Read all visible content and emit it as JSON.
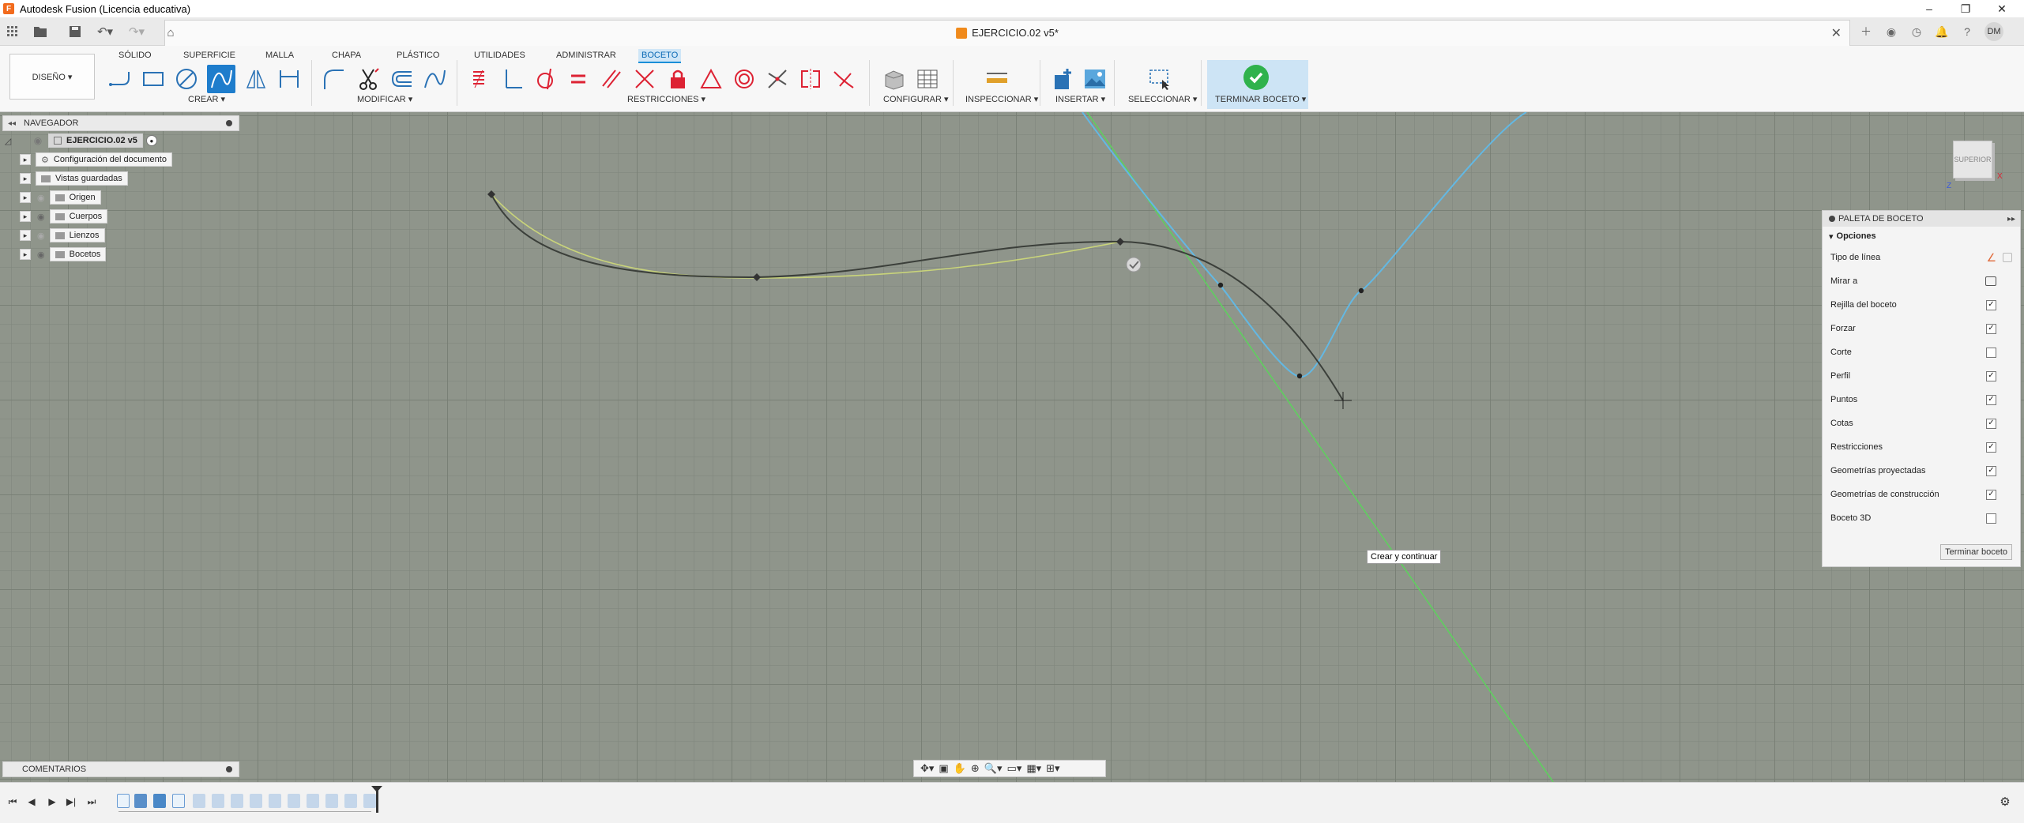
{
  "app": {
    "title": "Autodesk Fusion (Licencia educativa)"
  },
  "document": {
    "title": "EJERCICIO.02 v5*"
  },
  "toolbar": {
    "workspace": "DISEÑO ▾",
    "tabs": [
      "SÓLIDO",
      "SUPERFICIE",
      "MALLA",
      "CHAPA",
      "PLÁSTICO",
      "UTILIDADES",
      "ADMINISTRAR",
      "BOCETO"
    ],
    "active_tab": "BOCETO",
    "groups": {
      "create": "CREAR ▾",
      "modify": "MODIFICAR ▾",
      "constraints": "RESTRICCIONES ▾",
      "configure": "CONFIGURAR ▾",
      "inspect": "INSPECCIONAR ▾",
      "insert": "INSERTAR ▾",
      "select": "SELECCIONAR ▾",
      "finish": "TERMINAR BOCETO ▾"
    }
  },
  "user": {
    "initials": "DM"
  },
  "browser": {
    "title": "NAVEGADOR",
    "root": "EJERCICIO.02 v5",
    "items": [
      "Configuración del documento",
      "Vistas guardadas",
      "Origen",
      "Cuerpos",
      "Lienzos",
      "Bocetos"
    ]
  },
  "palette": {
    "title": "PALETA DE BOCETO",
    "section": "Opciones",
    "options": [
      {
        "label": "Tipo de línea",
        "kind": "icons"
      },
      {
        "label": "Mirar a",
        "kind": "icon"
      },
      {
        "label": "Rejilla del boceto",
        "checked": true
      },
      {
        "label": "Forzar",
        "checked": true
      },
      {
        "label": "Corte",
        "checked": false
      },
      {
        "label": "Perfil",
        "checked": true
      },
      {
        "label": "Puntos",
        "checked": true
      },
      {
        "label": "Cotas",
        "checked": true
      },
      {
        "label": "Restricciones",
        "checked": true
      },
      {
        "label": "Geometrías proyectadas",
        "checked": true
      },
      {
        "label": "Geometrías de construcción",
        "checked": true
      },
      {
        "label": "Boceto 3D",
        "checked": false
      }
    ],
    "finish_button": "Terminar boceto"
  },
  "tooltip": "Crear y continuar",
  "comments": {
    "title": "COMENTARIOS"
  },
  "viewcube": {
    "face": "SUPERIOR",
    "axis_z": "Z",
    "axis_x": "X"
  },
  "colors": {
    "accent": "#1e7dcc",
    "canvas": "#8f958b",
    "curve_dark": "#3b3f3a",
    "curve_preview": "#c9d47a",
    "curve_blue": "#63b8e3",
    "axis_green": "#5fcf5f"
  }
}
